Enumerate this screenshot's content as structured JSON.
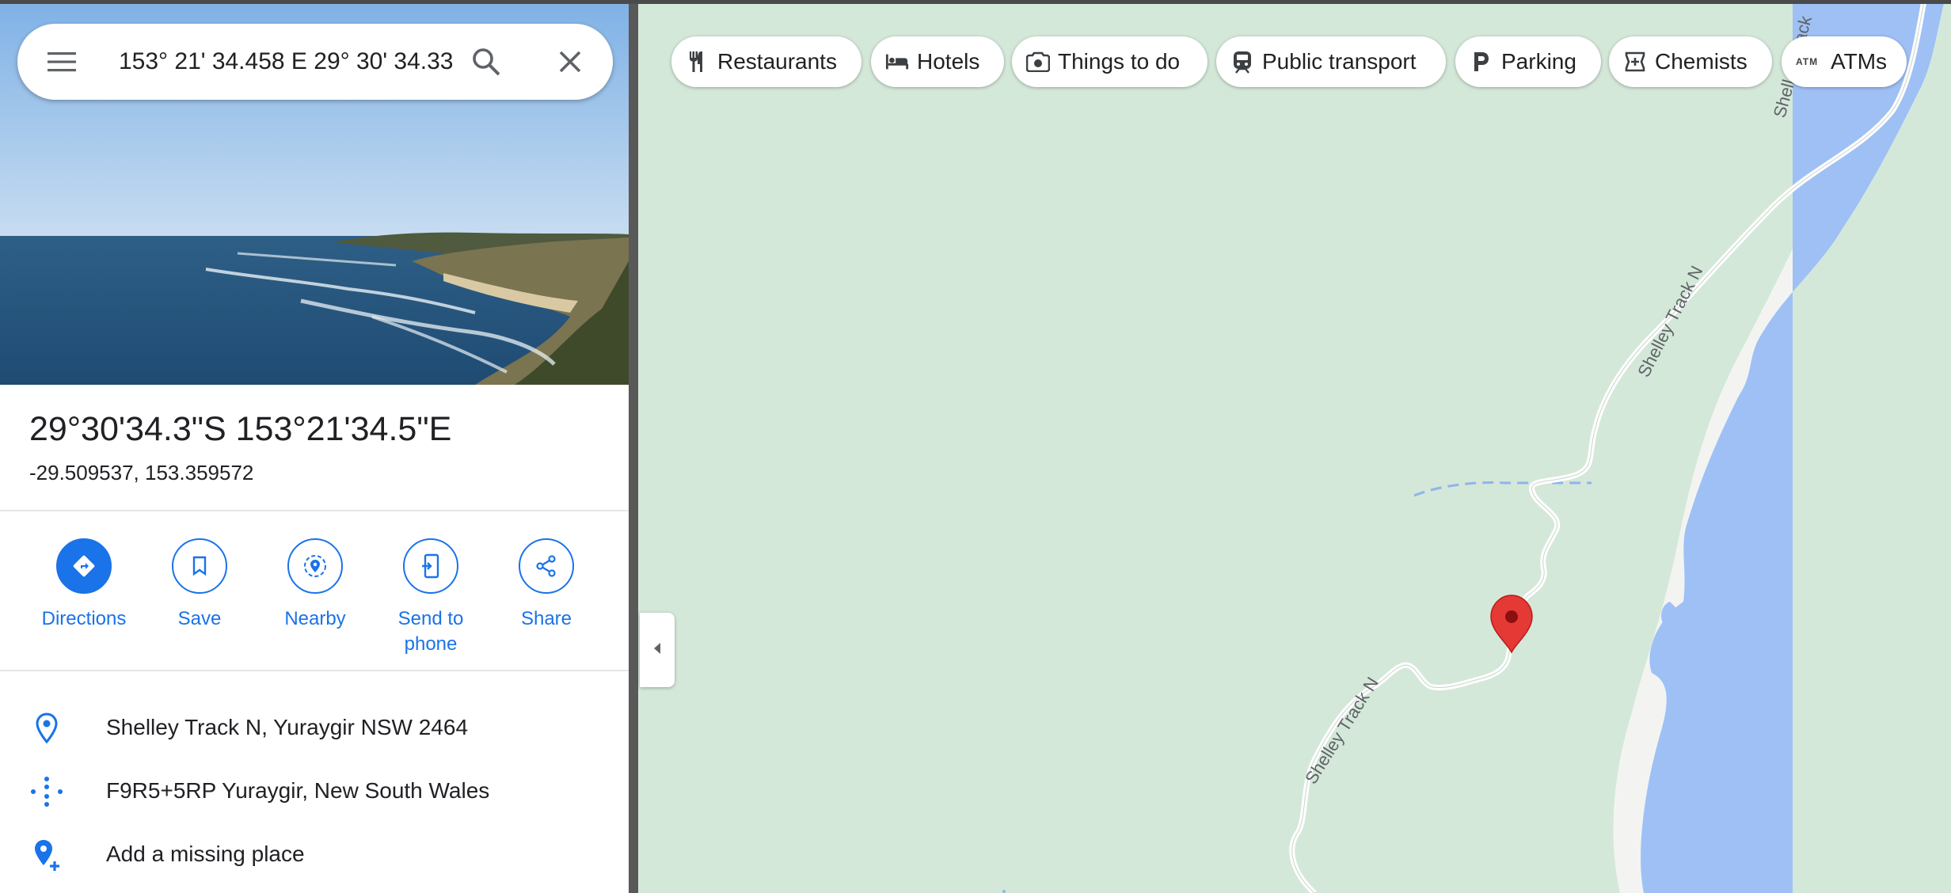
{
  "search": {
    "query": "153° 21' 34.458 E 29° 30' 34.33",
    "menu_icon": "menu-icon",
    "search_icon": "search-icon",
    "close_icon": "close-icon"
  },
  "place": {
    "title": "29°30'34.3\"S 153°21'34.5\"E",
    "decimal": "-29.509537, 153.359572"
  },
  "actions": [
    {
      "label": "Directions",
      "icon": "directions-icon"
    },
    {
      "label": "Save",
      "icon": "bookmark-icon"
    },
    {
      "label": "Nearby",
      "icon": "nearby-icon"
    },
    {
      "label": "Send to phone",
      "icon": "send-to-phone-icon"
    },
    {
      "label": "Share",
      "icon": "share-icon"
    }
  ],
  "info": {
    "address": "Shelley Track N, Yuraygir NSW 2464",
    "plus_code": "F9R5+5RP Yuraygir, New South Wales",
    "add_place": "Add a missing place"
  },
  "chips": [
    {
      "label": "Restaurants",
      "icon": "restaurant-icon"
    },
    {
      "label": "Hotels",
      "icon": "hotel-icon"
    },
    {
      "label": "Things to do",
      "icon": "camera-icon"
    },
    {
      "label": "Public transport",
      "icon": "train-icon"
    },
    {
      "label": "Parking",
      "icon": "parking-icon"
    },
    {
      "label": "Chemists",
      "icon": "chemist-icon"
    },
    {
      "label": "ATMs",
      "icon": "atm-icon"
    }
  ],
  "map": {
    "road_labels": [
      "Shelley Track N",
      "Shelley Track N",
      "Shelley Track"
    ],
    "colors": {
      "land": "#d4e8d9",
      "water": "#9fc0f5",
      "beach": "#f3f4f1",
      "pin": "#e53935",
      "accent": "#1a73e8"
    }
  }
}
